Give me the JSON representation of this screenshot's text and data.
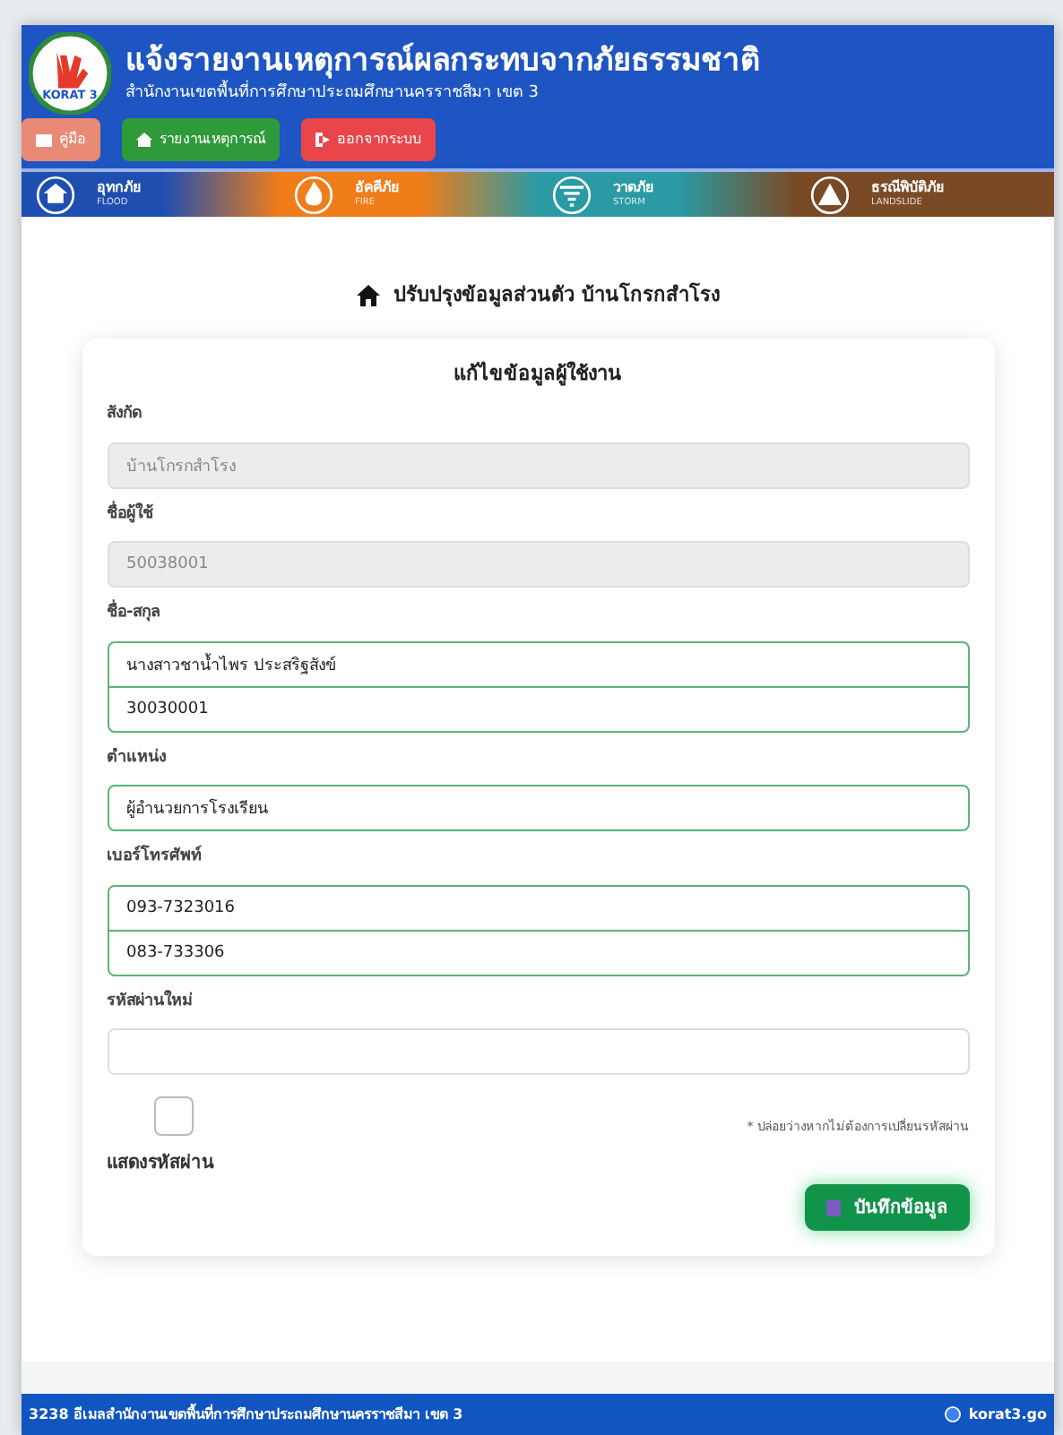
{
  "header": {
    "logo_text": "KORAT 3",
    "title": "แจ้งรายงานเหตุการณ์ผลกระทบจากภัยธรรมชาติ",
    "subtitle": "สำนักงานเขตพื้นที่การศึกษาประถมศึกษานครราชสีมา เขต 3",
    "buttons": [
      {
        "label": "คู่มือ",
        "kind": "manual"
      },
      {
        "label": "รายงานเหตุการณ์",
        "kind": "report"
      },
      {
        "label": "ออกจากระบบ",
        "kind": "logout"
      }
    ]
  },
  "disasters": [
    {
      "label": "อุทกภัย",
      "sub": "FLOOD",
      "color": "#1e4fb0",
      "kind": "flood"
    },
    {
      "label": "อัคคีภัย",
      "sub": "FIRE",
      "color": "#ef7d1a",
      "kind": "fire"
    },
    {
      "label": "วาตภัย",
      "sub": "STORM",
      "color": "#2a9aa4",
      "kind": "storm"
    },
    {
      "label": "ธรณีพิบัติภัย",
      "sub": "LANDSLIDE",
      "color": "#7a4a26",
      "kind": "landslide"
    }
  ],
  "page_heading": "ปรับปรุงข้อมูลส่วนตัว บ้านโกรกสำโรง",
  "form": {
    "title": "แก้ไขข้อมูลผู้ใช้งาน",
    "fields": [
      {
        "label": "สังกัด",
        "values": [
          "บ้านโกรกสำโรง"
        ],
        "disabled": true
      },
      {
        "label": "ชื่อผู้ใช้",
        "values": [
          "50038001"
        ],
        "disabled": true
      },
      {
        "label": "ชื่อ-สกุล",
        "values": [
          "นางสาวชาน้ำไพร ประสริฐสังข์",
          "30030001"
        ],
        "disabled": false
      },
      {
        "label": "ตำแหน่ง",
        "values": [
          "ผู้อำนวยการโรงเรียน"
        ],
        "disabled": false
      },
      {
        "label": "เบอร์โทรศัพท์",
        "values": [
          "093-7323016",
          "083-733306"
        ],
        "disabled": false
      },
      {
        "label": "รหัสผ่านใหม่",
        "disabled": false
      }
    ],
    "show_password": {
      "label": "แสดงรหัสผ่าน",
      "checked": false
    },
    "note": "* ปล่อยว่างหากไม่ต้องการเปลี่ยนรหัสผ่าน",
    "save_button": "บันทึกข้อมูล"
  },
  "footer": {
    "left": "3238 อีเมลสำนักงานเขตพื้นที่การศึกษาประถมศึกษานครราชสีมา เขต 3",
    "right": "korat3.go"
  }
}
